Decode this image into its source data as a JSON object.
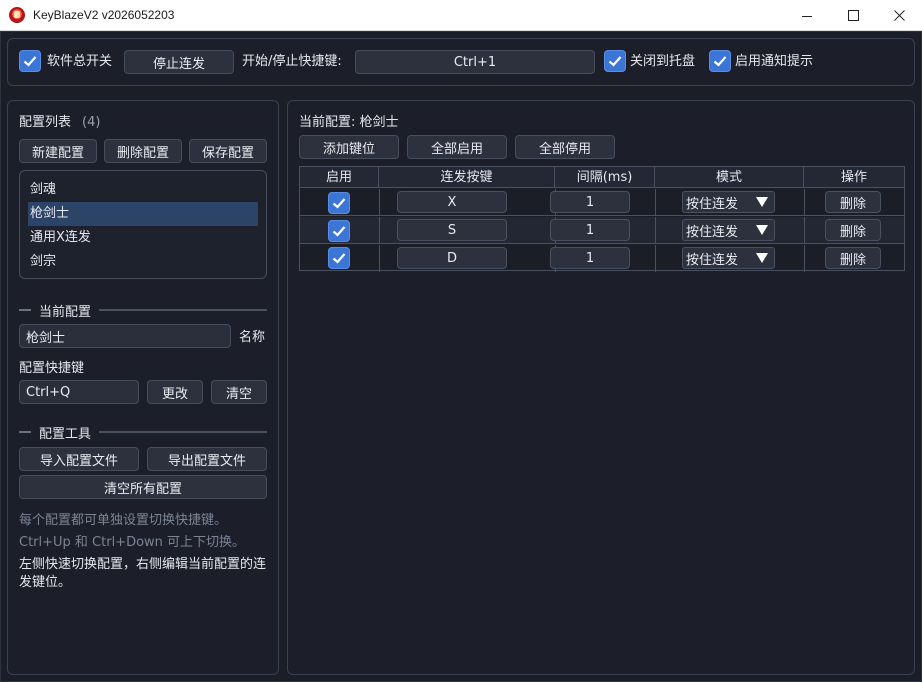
{
  "window": {
    "title": "KeyBlazeV2 v2026052203"
  },
  "topbar": {
    "master_switch": "软件总开关",
    "stop_button": "停止连发",
    "hotkey_label": "开始/停止快捷键:",
    "hotkey_value": "Ctrl+1",
    "close_to_tray": "关闭到托盘",
    "enable_notify": "启用通知提示"
  },
  "left": {
    "list_title": "配置列表",
    "list_count": "(4)",
    "new_button": "新建配置",
    "delete_button": "删除配置",
    "save_button": "保存配置",
    "configs": [
      "剑魂",
      "枪剑士",
      "通用X连发",
      "剑宗"
    ],
    "selected_index": 1,
    "current_section": "当前配置",
    "name_value": "枪剑士",
    "name_label": "名称",
    "hotkey_title": "配置快捷键",
    "hotkey_value": "Ctrl+Q",
    "change_button": "更改",
    "clear_button": "清空",
    "tools_section": "配置工具",
    "import_button": "导入配置文件",
    "export_button": "导出配置文件",
    "clear_all_button": "清空所有配置",
    "hint1": "每个配置都可单独设置切换快捷键。",
    "hint2": "Ctrl+Up 和 Ctrl+Down 可上下切换。",
    "note": "左侧快速切换配置，右侧编辑当前配置的连发键位。"
  },
  "right": {
    "current_label": "当前配置: 枪剑士",
    "add_button": "添加键位",
    "enable_all_button": "全部启用",
    "disable_all_button": "全部停用",
    "table": {
      "headers": [
        "启用",
        "连发按键",
        "间隔(ms)",
        "模式",
        "操作"
      ],
      "rows": [
        {
          "enabled": true,
          "key": "X",
          "interval": "1",
          "mode": "按住连发",
          "action": "删除"
        },
        {
          "enabled": true,
          "key": "S",
          "interval": "1",
          "mode": "按住连发",
          "action": "删除"
        },
        {
          "enabled": true,
          "key": "D",
          "interval": "1",
          "mode": "按住连发",
          "action": "删除"
        }
      ]
    }
  },
  "colors": {
    "accent": "#3b76d6",
    "selected": "#2b4468",
    "background": "#1b1e27"
  }
}
